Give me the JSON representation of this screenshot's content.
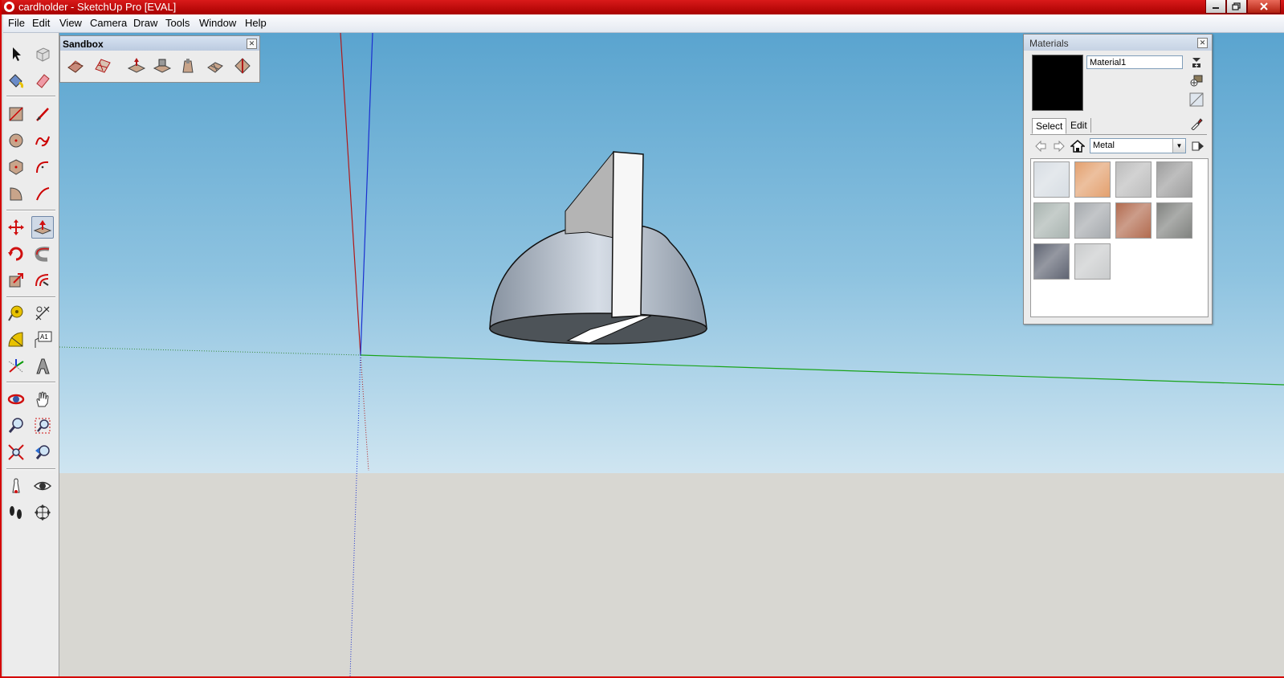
{
  "window": {
    "title": "cardholder - SketchUp Pro [EVAL]",
    "controls": [
      "minimize-icon",
      "maximize-icon",
      "close-icon"
    ],
    "accent_color": "#d40000"
  },
  "menu": [
    "File",
    "Edit",
    "View",
    "Camera",
    "Draw",
    "Tools",
    "Window",
    "Help"
  ],
  "left_toolbar": {
    "groups": [
      [
        "select",
        "make-component"
      ],
      [
        "paint-bucket",
        "eraser"
      ],
      [
        "rectangle",
        "line"
      ],
      [
        "circle",
        "freehand"
      ],
      [
        "polygon",
        "arc"
      ],
      [
        "pie",
        "two-point-arc"
      ],
      [
        "move",
        "push-pull"
      ],
      [
        "rotate",
        "follow-me"
      ],
      [
        "scale",
        "offset"
      ],
      [
        "tape-measure",
        "dimension"
      ],
      [
        "protractor",
        "text"
      ],
      [
        "axes",
        "3d-text"
      ],
      [
        "orbit",
        "pan"
      ],
      [
        "zoom",
        "zoom-window"
      ],
      [
        "zoom-extents",
        "previous-view"
      ],
      [
        "position-camera",
        "look-around"
      ],
      [
        "walk",
        "section-plane"
      ]
    ],
    "active_tool": "push-pull"
  },
  "sandbox_toolbar": {
    "title": "Sandbox",
    "tools": [
      "from-contours",
      "from-scratch",
      "smoove",
      "stamp",
      "drape",
      "add-detail",
      "flip-edge"
    ]
  },
  "materials": {
    "title": "Materials",
    "current_material": "Material1",
    "current_color": "#000000",
    "tabs": [
      "Select",
      "Edit"
    ],
    "selected_tab": "Select",
    "library": "Metal",
    "swatches": [
      {
        "name": "metal-aluminum",
        "color": "#d7dde3"
      },
      {
        "name": "metal-copper-pattern",
        "color": "#e3a06e"
      },
      {
        "name": "metal-brushed-chrome",
        "color": "#bcbcbc"
      },
      {
        "name": "metal-embossed",
        "color": "#9d9d9d"
      },
      {
        "name": "metal-corrugated",
        "color": "#a9b4b0"
      },
      {
        "name": "metal-steel",
        "color": "#a5a9ad"
      },
      {
        "name": "metal-rusted",
        "color": "#b26b4f"
      },
      {
        "name": "metal-dark-steel",
        "color": "#80827f"
      },
      {
        "name": "metal-perforated",
        "color": "#5f6472"
      },
      {
        "name": "metal-diamond-plate",
        "color": "#c9cbcc"
      }
    ]
  },
  "scene": {
    "sky_color": "#6fb1d8",
    "ground_color": "#d8d7d2",
    "model": "cardholder"
  }
}
